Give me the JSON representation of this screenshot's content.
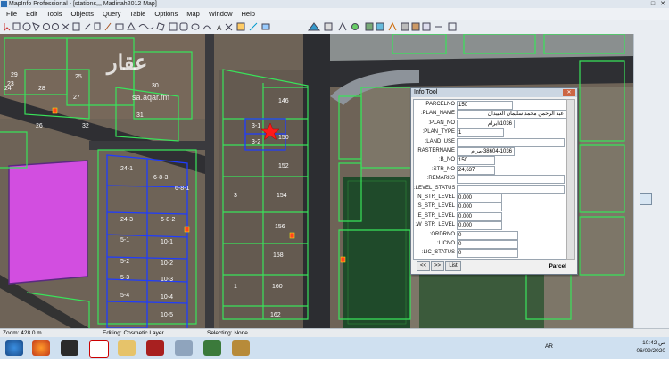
{
  "window": {
    "title": "MapInfo Professional - [stations,,, Madinah2012 Map]"
  },
  "menu": [
    "File",
    "Edit",
    "Tools",
    "Objects",
    "Query",
    "Table",
    "Options",
    "Map",
    "Window",
    "Help"
  ],
  "watermark": {
    "logo": "عقار",
    "site": "sa.aqar.fm"
  },
  "lots": [
    "29",
    "28",
    "27",
    "26",
    "25",
    "24",
    "23",
    "31",
    "30",
    "32",
    "146",
    "150",
    "152",
    "154",
    "156",
    "158",
    "160",
    "162",
    "3-1",
    "3-2",
    "24-1",
    "6-8-3",
    "6-8-1",
    "24-3",
    "6-8-2",
    "5-1",
    "10-1",
    "5-2",
    "10-2",
    "5-3",
    "10-3",
    "5-4",
    "10-4",
    "10-5",
    "1",
    "3"
  ],
  "info_tool": {
    "title": "Info Tool",
    "rows": [
      {
        "label": ":PARCELNO",
        "value": "150"
      },
      {
        "label": ":PLAN_NAME",
        "value": "عبد الرحمن محمد سليمان العبيدان"
      },
      {
        "label": ":PLAN_NO",
        "value": "1036/ايرام"
      },
      {
        "label": ":PLAN_TYPE",
        "value": "1"
      },
      {
        "label": ":LAND_USE",
        "value": ""
      },
      {
        "label": ":RASTERNAME",
        "value": "38604-1036-مرام"
      },
      {
        "label": ":B_NO",
        "value": "150"
      },
      {
        "label": ":STR_NO",
        "value": "24,637"
      },
      {
        "label": ":REMARKS",
        "value": ""
      },
      {
        "label": ":LEVEL_STATUS",
        "value": ""
      },
      {
        "label": ":N_STR_LEVEL",
        "value": "0.000"
      },
      {
        "label": ":S_STR_LEVEL",
        "value": "0.000"
      },
      {
        "label": ":E_STR_LEVEL",
        "value": "0.000"
      },
      {
        "label": ":W_STR_LEVEL",
        "value": "0.000"
      },
      {
        "label": ":ORDRNO",
        "value": "0"
      },
      {
        "label": ":LICNO",
        "value": "0"
      },
      {
        "label": ":LIC_STATUS",
        "value": "0"
      }
    ],
    "nav_prev": "<<",
    "nav_next": ">>",
    "list_button": "List",
    "table_name": "Parcel"
  },
  "status": {
    "zoom": "Zoom: 428.0 m",
    "editing": "Editing: Cosmetic Layer",
    "selecting": "Selecting: None"
  },
  "tray": {
    "lang": "AR",
    "time": "10:42 ص",
    "date": "06/09/2020"
  },
  "colors": {
    "parcel_line": "#39e35a",
    "selected_line": "#1f3cff",
    "magenta_area": "#d24ee0",
    "marker": "#ff1a1a"
  }
}
